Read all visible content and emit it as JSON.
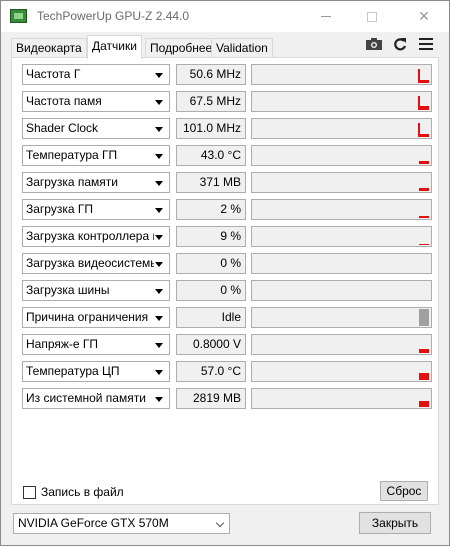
{
  "window": {
    "title": "TechPowerUp GPU-Z 2.44.0",
    "min_glyph": "",
    "close_glyph": "✕"
  },
  "tabs": [
    {
      "label": "Видеокарта",
      "active": false
    },
    {
      "label": "Датчики",
      "active": true
    },
    {
      "label": "Подробнее",
      "active": false
    },
    {
      "label": "Validation",
      "active": false
    }
  ],
  "toolbar": {
    "icons": [
      "camera-icon",
      "refresh-icon",
      "menu-icon"
    ]
  },
  "sensors": [
    {
      "name": "Частота Г",
      "value": "50.6 MHz",
      "level": 0.35,
      "shape": "L"
    },
    {
      "name": "Частота памя",
      "value": "67.5 MHz",
      "level": 0.5,
      "shape": "L"
    },
    {
      "name": "Shader Clock",
      "value": "101.0 MHz",
      "level": 0.4,
      "shape": "L"
    },
    {
      "name": "Температура ГП",
      "value": "43.0 °C",
      "level": 0.15,
      "shape": "bar"
    },
    {
      "name": "Загрузка памяти",
      "value": "371 MB",
      "level": 0.15,
      "shape": "bar"
    },
    {
      "name": "Загрузка ГП",
      "value": "2 %",
      "level": 0.12,
      "shape": "bar"
    },
    {
      "name": "Загрузка контроллера па...",
      "value": "9 %",
      "level": 0.06,
      "shape": "bar"
    },
    {
      "name": "Загрузка видеосистемы",
      "value": "0 %",
      "level": 0,
      "shape": "none"
    },
    {
      "name": "Загрузка шины",
      "value": "0 %",
      "level": 0,
      "shape": "none"
    },
    {
      "name": "Причина ограничения",
      "value": "Idle",
      "level": 1.0,
      "shape": "gray"
    },
    {
      "name": "Напряж-е ГП",
      "value": "0.8000 V",
      "level": 0.2,
      "shape": "bar"
    },
    {
      "name": "Температура ЦП",
      "value": "57.0 °C",
      "level": 0.35,
      "shape": "bar"
    },
    {
      "name": "Из системной памяти",
      "value": "2819 MB",
      "level": 0.3,
      "shape": "bar"
    }
  ],
  "footer": {
    "log_label": "Запись в файл",
    "log_checked": false,
    "reset_label": "Сброс",
    "gpu_selected": "NVIDIA GeForce GTX 570M",
    "close_label": "Закрыть"
  },
  "colors": {
    "graph": "#e41010",
    "graph_gray": "#a0a0a0"
  }
}
